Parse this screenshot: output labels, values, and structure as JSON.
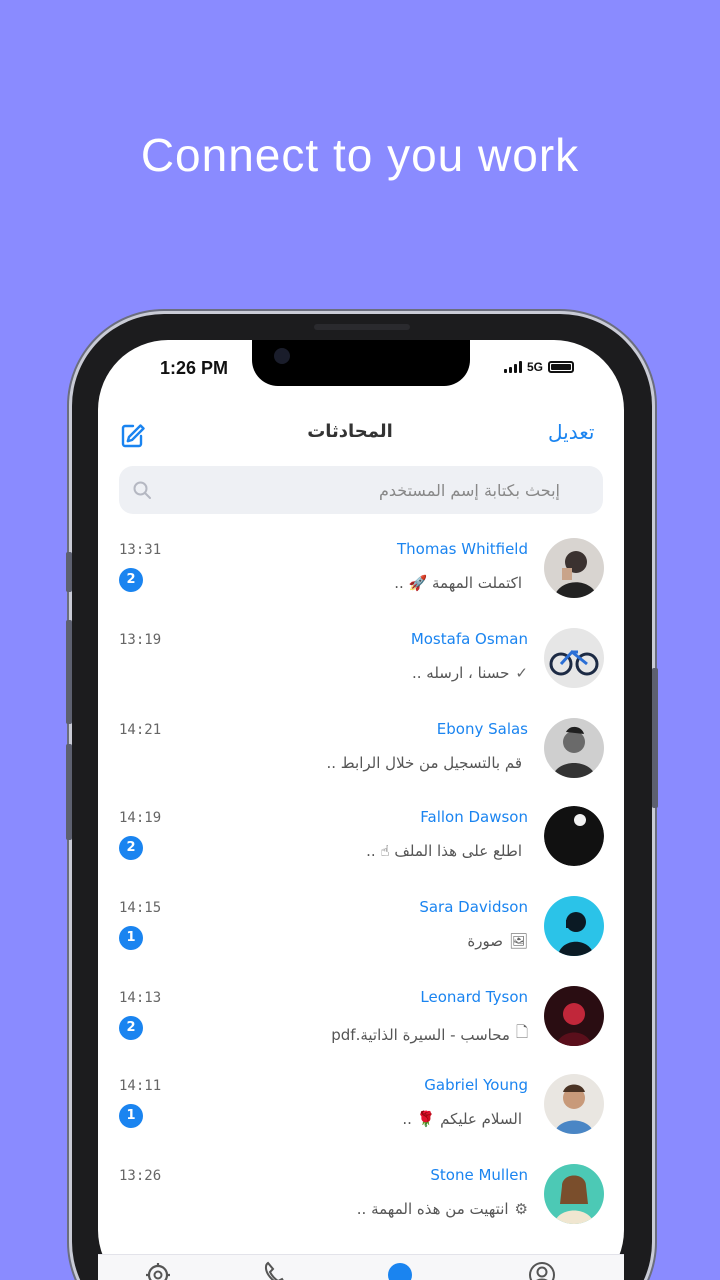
{
  "headline": "Connect to you work",
  "status_bar": {
    "time": "1:26 PM",
    "network": "5G"
  },
  "nav": {
    "edit_label": "تعديل",
    "title": "المحادثات",
    "compose_icon": "compose-icon"
  },
  "search": {
    "placeholder": "إبحث بكتابة إسم المستخدم",
    "icon": "search-icon"
  },
  "colors": {
    "background": "#8a8bff",
    "accent": "#1a84f0"
  },
  "chats": [
    {
      "name": "Thomas Whitfield",
      "preview": "اكتملت المهمة 🚀 ..",
      "time": "13:31",
      "unread": "2",
      "preview_icon": ""
    },
    {
      "name": "Mostafa Osman",
      "preview": "حسنا ، ارسله ..",
      "time": "13:19",
      "unread": "",
      "preview_icon": "✓"
    },
    {
      "name": "Ebony Salas",
      "preview": "قم بالتسجيل من خلال الرابط ..",
      "time": "14:21",
      "unread": "",
      "preview_icon": ""
    },
    {
      "name": "Fallon Dawson",
      "preview": "اطلع على هذا الملف ☝ ..",
      "time": "14:19",
      "unread": "2",
      "preview_icon": ""
    },
    {
      "name": "Sara Davidson",
      "preview": "صورة",
      "time": "14:15",
      "unread": "1",
      "preview_icon": "🖼"
    },
    {
      "name": "Leonard Tyson",
      "preview": "محاسب - السيرة الذاتية.pdf",
      "time": "14:13",
      "unread": "2",
      "preview_icon": "🗋"
    },
    {
      "name": "Gabriel Young",
      "preview": "السلام عليكم 🌹 ..",
      "time": "14:11",
      "unread": "1",
      "preview_icon": ""
    },
    {
      "name": "Stone Mullen",
      "preview": "انتهيت من هذه المهمة ..",
      "time": "13:26",
      "unread": "",
      "preview_icon": "⚙"
    }
  ],
  "tabbar": {
    "tabs": [
      "settings-icon",
      "calls-icon",
      "chats-icon",
      "profile-icon"
    ]
  }
}
